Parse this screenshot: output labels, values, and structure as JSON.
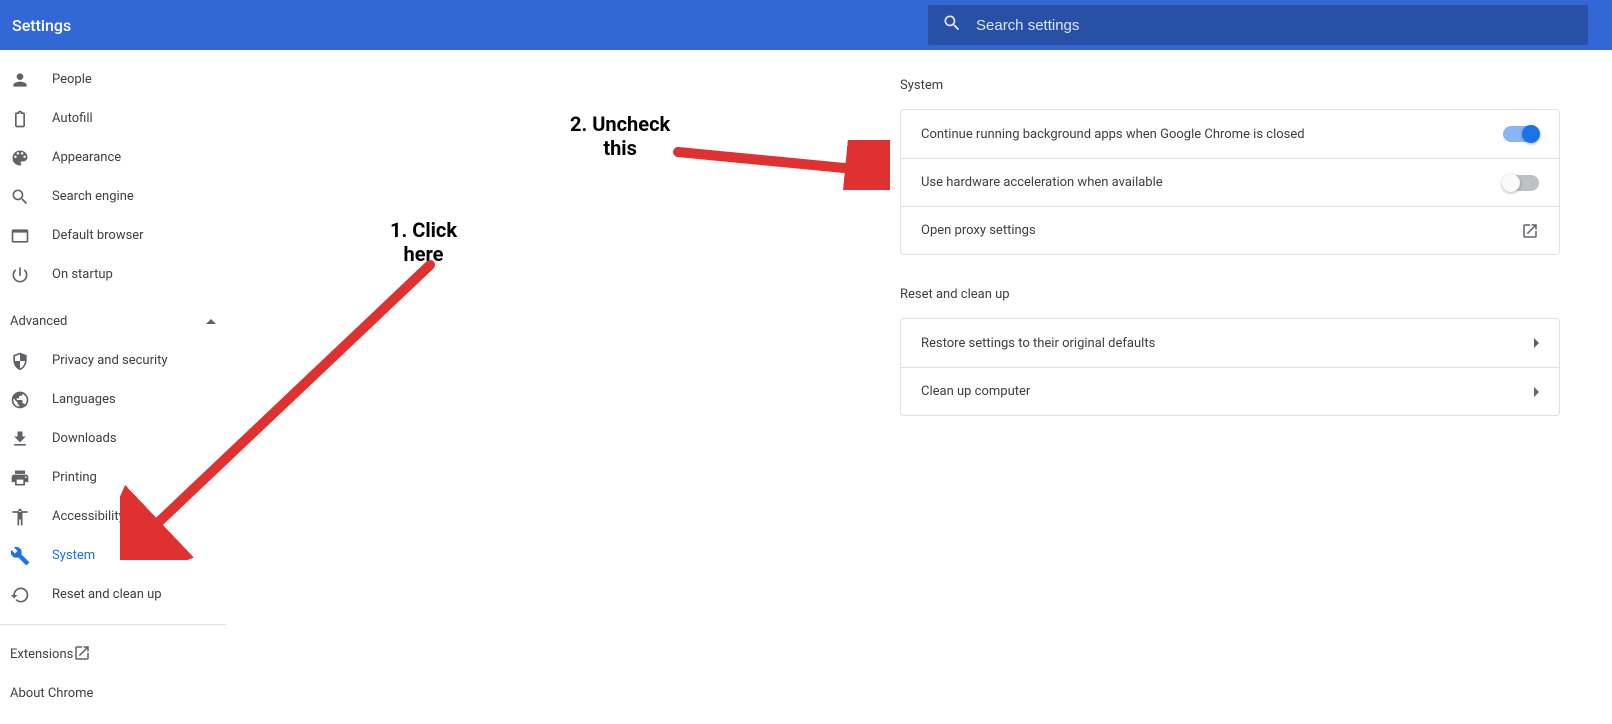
{
  "header": {
    "title": "Settings"
  },
  "search": {
    "placeholder": "Search settings"
  },
  "sidebar": {
    "items": [
      {
        "label": "People"
      },
      {
        "label": "Autofill"
      },
      {
        "label": "Appearance"
      },
      {
        "label": "Search engine"
      },
      {
        "label": "Default browser"
      },
      {
        "label": "On startup"
      }
    ],
    "advanced_label": "Advanced",
    "advanced_items": [
      {
        "label": "Privacy and security"
      },
      {
        "label": "Languages"
      },
      {
        "label": "Downloads"
      },
      {
        "label": "Printing"
      },
      {
        "label": "Accessibility"
      },
      {
        "label": "System"
      },
      {
        "label": "Reset and clean up"
      }
    ],
    "extensions_label": "Extensions",
    "about_label": "About Chrome"
  },
  "content": {
    "system_title": "System",
    "rows": {
      "bg_apps": "Continue running background apps when Google Chrome is closed",
      "hw_accel": "Use hardware acceleration when available",
      "proxy": "Open proxy settings"
    },
    "reset_title": "Reset and clean up",
    "reset_rows": {
      "restore": "Restore settings to their original defaults",
      "cleanup": "Clean up computer"
    }
  },
  "annotations": {
    "a1_line1": "1. Click",
    "a1_line2": "here",
    "a2_line1": "2. Uncheck",
    "a2_line2": "this"
  }
}
